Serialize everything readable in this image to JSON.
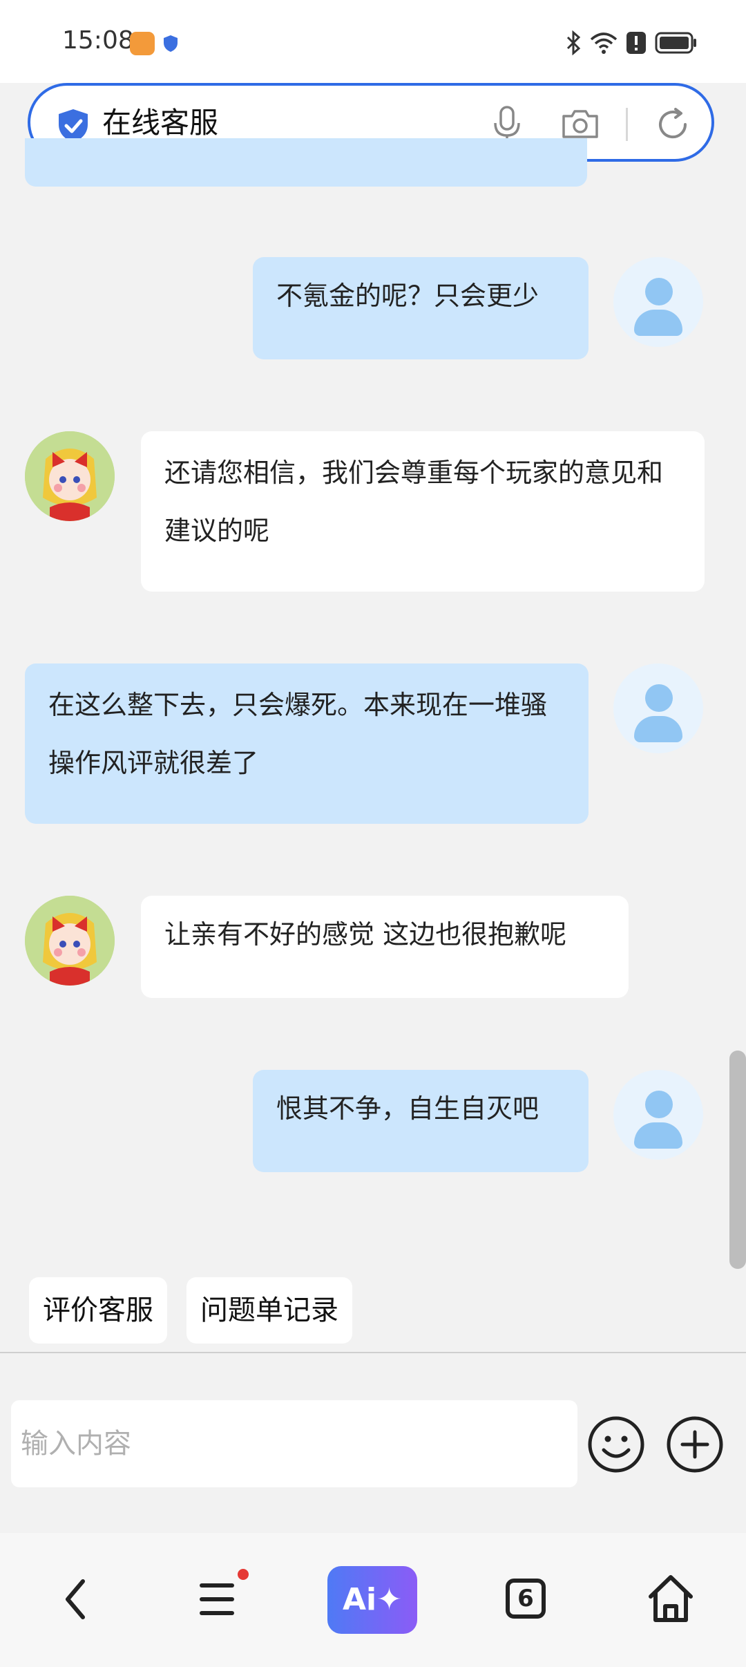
{
  "status_bar": {
    "time": "15:08",
    "icons": [
      "app-notification-icon",
      "shield-icon",
      "bluetooth-icon",
      "wifi-icon",
      "alert-icon",
      "battery-icon"
    ]
  },
  "address_bar": {
    "title": "在线客服",
    "icons": [
      "shield-check-icon",
      "microphone-icon",
      "camera-icon",
      "reload-icon"
    ],
    "accent_color": "#2f6be6"
  },
  "messages": [
    {
      "sender": "user",
      "text": "不氪金的呢？只会更少"
    },
    {
      "sender": "agent",
      "text": "还请您相信，我们会尊重每个玩家的意见和建议的呢"
    },
    {
      "sender": "user",
      "text": "在这么整下去，只会爆死。本来现在一堆骚操作风评就很差了"
    },
    {
      "sender": "agent",
      "text": "让亲有不好的感觉 这边也很抱歉呢"
    },
    {
      "sender": "user",
      "text": "恨其不争，自生自灭吧"
    }
  ],
  "quick_actions": [
    "评价客服",
    "问题单记录"
  ],
  "composer": {
    "placeholder": "输入内容",
    "icons": [
      "emoji-icon",
      "plus-icon"
    ]
  },
  "bottom_nav": {
    "ai_label": "Ai✦",
    "tabs_count": "6",
    "icons": [
      "back-icon",
      "menu-icon",
      "ai-assistant-icon",
      "tabs-icon",
      "home-icon"
    ]
  },
  "colors": {
    "user_bubble": "#cce6fd",
    "agent_bubble": "#ffffff",
    "background": "#f2f2f2"
  }
}
